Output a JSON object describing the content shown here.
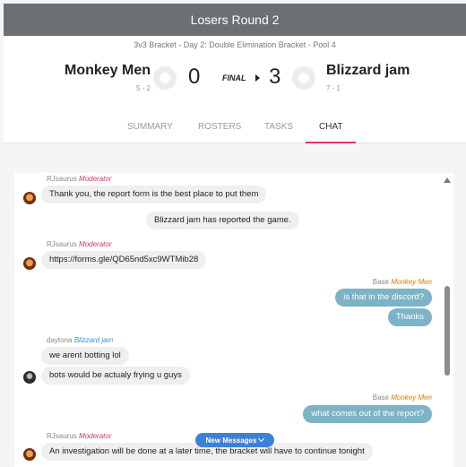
{
  "header": {
    "title": "Losers Round 2"
  },
  "match": {
    "subtitle": "3v3 Bracket - Day 2: Double Elimination Bracket - Pool 4",
    "status": "FINAL",
    "team_left": {
      "name": "Monkey Men",
      "record": "5 - 2",
      "score": "0"
    },
    "team_right": {
      "name": "Blizzard jam",
      "record": "7 - 1",
      "score": "3"
    }
  },
  "tabs": [
    {
      "label": "SUMMARY"
    },
    {
      "label": "ROSTERS"
    },
    {
      "label": "TASKS"
    },
    {
      "label": "CHAT",
      "active": true
    }
  ],
  "chat": {
    "messages": [
      {
        "author": "RJsaurus",
        "role": "Moderator",
        "text": "Thank you, the report form is the best place to put them"
      },
      {
        "system": true,
        "text": "Blizzard jam has reported the game."
      },
      {
        "author": "RJsaurus",
        "role": "Moderator",
        "text": "https://forms.gle/QD65nd5xc9WTMib28"
      },
      {
        "author": "Base",
        "role": "Monkey Men",
        "text": "is that in the discord?"
      },
      {
        "author": "Base",
        "role": "Monkey Men",
        "text": "Thanks"
      },
      {
        "author": "daytona",
        "role": "Blizzard jam",
        "text": "we arent botting lol"
      },
      {
        "author": "daytona",
        "role": "Blizzard jam",
        "text": "bots would be actualy frying u guys"
      },
      {
        "author": "Base",
        "role": "Monkey Men",
        "text": "what comes out of the report?"
      },
      {
        "author": "RJsaurus",
        "role": "Moderator",
        "text": "An investigation will be done at a later time, the bracket will have to continue tonight"
      }
    ],
    "new_messages_label": "New Messages"
  },
  "colors": {
    "title_bar": "#6b7075",
    "active_tab_underline": "#e8336b",
    "outgoing_bubble": "#7db3c6",
    "moderator_role": "#d2386c",
    "monkey_men_role": "#e07b10",
    "blizzard_jam_role": "#3f8de0",
    "new_messages_pill": "#3b82d6"
  },
  "icons": [
    "team-logo-placeholder-icon",
    "play-arrow-icon",
    "scroll-up-icon",
    "chevron-down-icon"
  ]
}
